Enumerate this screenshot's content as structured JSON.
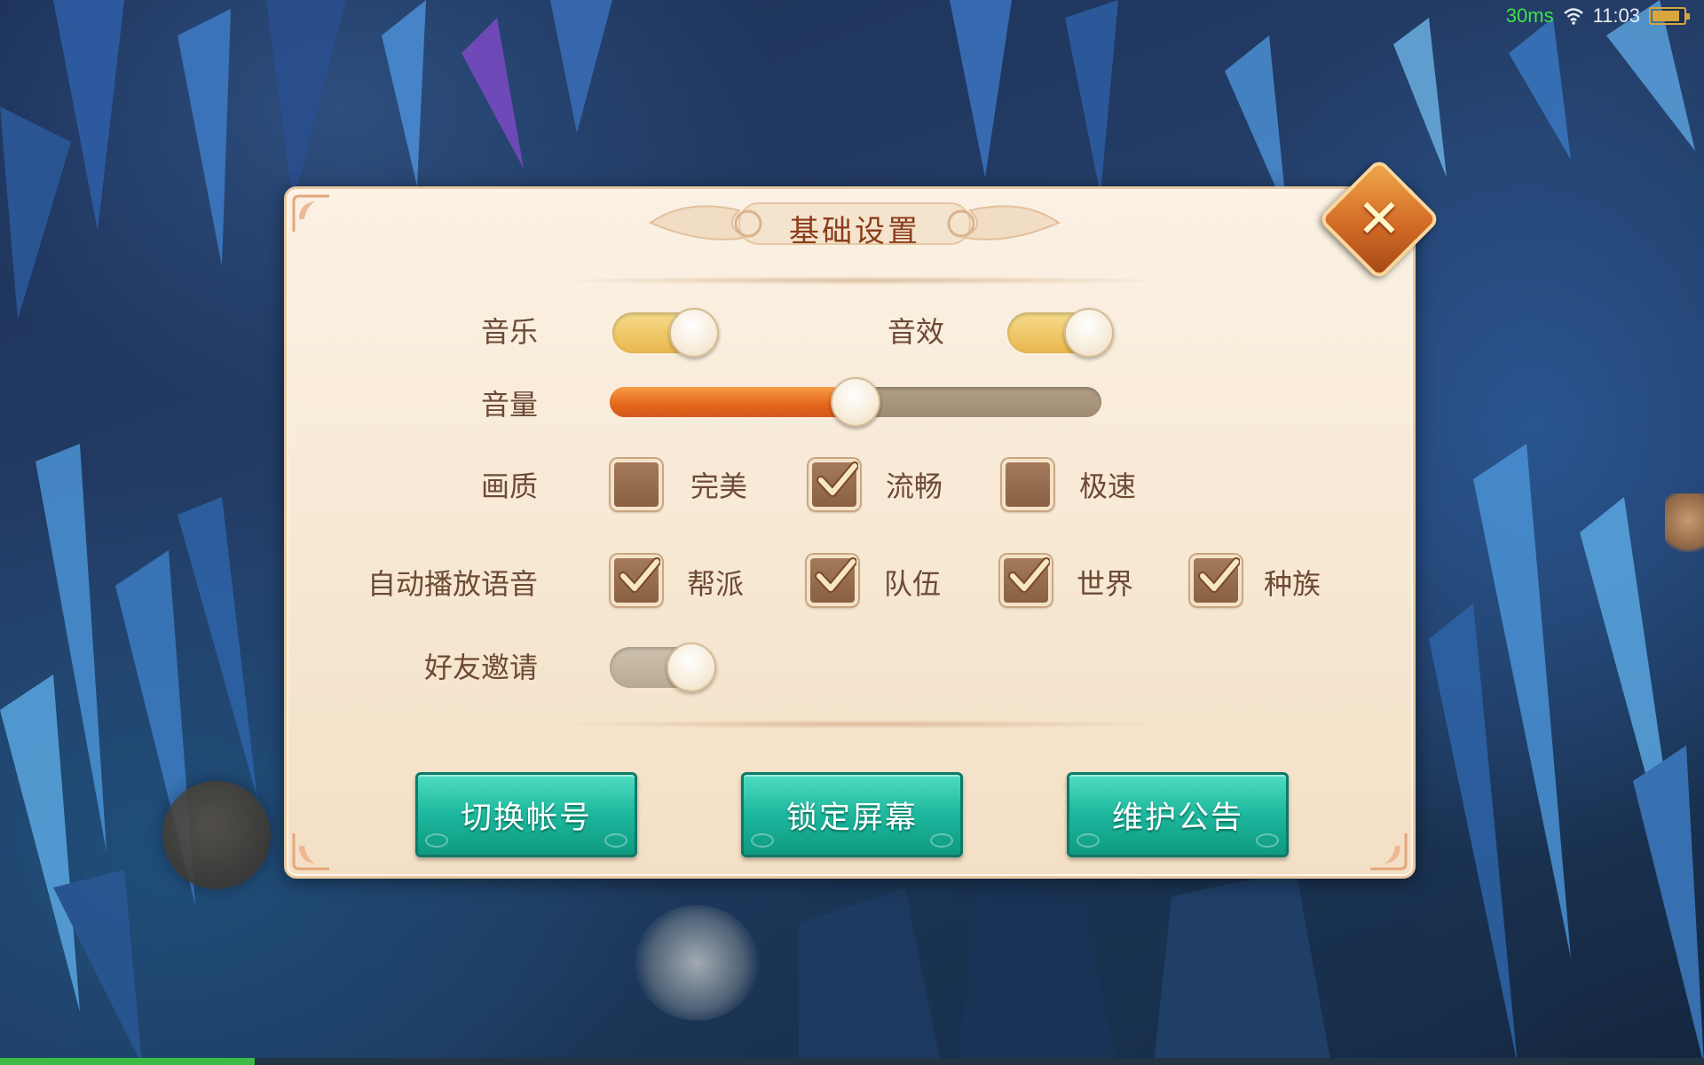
{
  "status_bar": {
    "ping": "30ms",
    "time": "11:03",
    "battery_level": 0.9
  },
  "dialog": {
    "title": "基础设置",
    "close_icon": "close-icon",
    "music": {
      "label": "音乐",
      "on": true
    },
    "sound_effects": {
      "label": "音效",
      "on": true
    },
    "volume": {
      "label": "音量",
      "level": 0.5
    },
    "quality": {
      "label": "画质",
      "options": [
        {
          "label": "完美",
          "checked": false
        },
        {
          "label": "流畅",
          "checked": true
        },
        {
          "label": "极速",
          "checked": false
        }
      ]
    },
    "auto_voice": {
      "label": "自动播放语音",
      "options": [
        {
          "label": "帮派",
          "checked": true
        },
        {
          "label": "队伍",
          "checked": true
        },
        {
          "label": "世界",
          "checked": true
        },
        {
          "label": "种族",
          "checked": true
        }
      ]
    },
    "friend_invite": {
      "label": "好友邀请",
      "on": false
    },
    "buttons": {
      "switch_account": "切换帐号",
      "lock_screen": "锁定屏幕",
      "maintenance_notice": "维护公告"
    }
  },
  "colors": {
    "accent": "#1cb79d",
    "panel": "#f7e8d3",
    "text": "#6d4a35",
    "title": "#8b3d1a"
  }
}
